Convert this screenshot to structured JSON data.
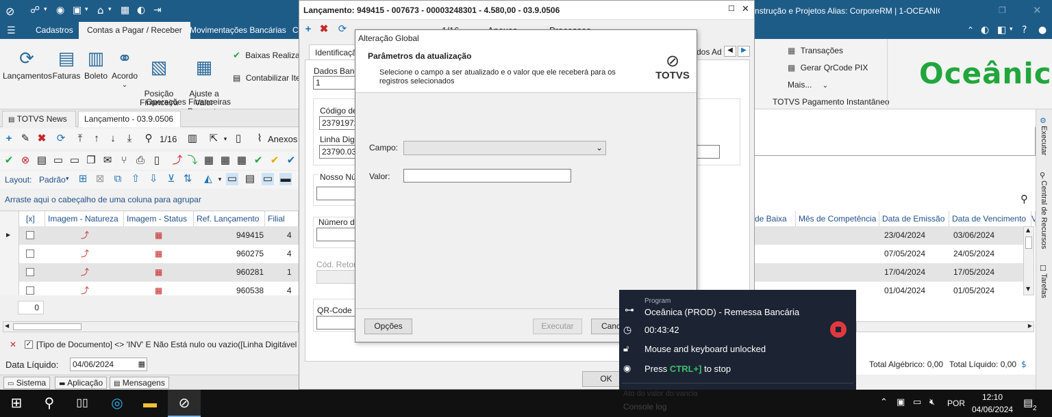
{
  "titlebar": {
    "right_text": "nstrução e Projetos  Alias: CorporeRM | 1-OCEANICA ENG..."
  },
  "menu": {
    "tabs": [
      "Cadastros",
      "Contas a Pagar / Receber",
      "Movimentações Bancárias",
      "C"
    ],
    "active": 1
  },
  "ribbon": {
    "buttons": [
      {
        "label": "Lançamentos",
        "icon": "refresh-money-icon"
      },
      {
        "label": "Faturas",
        "icon": "document-icon"
      },
      {
        "label": "Boleto",
        "icon": "barcode-icon"
      },
      {
        "label": "Acordo",
        "icon": "handshake-icon"
      },
      {
        "label": "Posição\nFinanceira",
        "icon": "report-icon"
      },
      {
        "label": "Ajuste a Valor\nPresente",
        "icon": "calculator-icon"
      }
    ],
    "small_items": [
      "Baixas Realizad",
      "Contabilizar Ite"
    ],
    "group_label": "Operações Financeiras",
    "right_items": [
      "Transações",
      "Gerar QrCode PIX",
      "Mais..."
    ],
    "right_group_label": "TOTVS Pagamento Instantâneo",
    "brand": "Oceânica"
  },
  "doctabs": {
    "tab1": "TOTVS News",
    "tab2": "Lançamento - 03.9.0506"
  },
  "toolbar": {
    "counter": "1/16",
    "anexos": "Anexos",
    "layout_label": "Layout:",
    "layout_value": "Padrão"
  },
  "grid": {
    "group_hint": "Arraste aqui o cabeçalho de uma coluna para agrupar",
    "columns": [
      "[x]",
      "Imagem - Natureza",
      "Imagem - Status",
      "Ref. Lançamento",
      "Filial"
    ],
    "right_columns": [
      "de Baixa",
      "Mês de Competência",
      "Data de Emissão",
      "Data de Vencimento",
      "V"
    ],
    "rows": [
      {
        "ref": "949415",
        "filial": "4",
        "emissao": "23/04/2024",
        "vencimento": "03/06/2024"
      },
      {
        "ref": "960275",
        "filial": "4",
        "emissao": "07/05/2024",
        "vencimento": "24/05/2024"
      },
      {
        "ref": "960281",
        "filial": "1",
        "emissao": "17/04/2024",
        "vencimento": "17/05/2024"
      },
      {
        "ref": "960538",
        "filial": "4",
        "emissao": "01/04/2024",
        "vencimento": "01/05/2024"
      }
    ],
    "footer_count": "0"
  },
  "filter": {
    "text": "[Tipo de Documento] <> 'INV' E Não Está nulo ou vazio([Linha Digitável (IPTE)])",
    "data_liquido_label": "Data Líquido:",
    "data_liquido_value": "04/06/2024"
  },
  "totals": {
    "algebrico": "Total Algébrico: 0,00",
    "liquido": "Total Líquido: 0,00"
  },
  "statusbar": [
    "Sistema",
    "Aplicação",
    "Mensagens"
  ],
  "lancamento_dialog": {
    "title": "Lançamento: 949415 - 007673 - 00003248301 - 4.580,00 - 03.9.0506",
    "counter": "1/16",
    "anexos": "Anexos",
    "processos": "Processos",
    "tab_identificacao": "Identificaçã",
    "tab_dados_ad": "dos Ad",
    "dados_bancarios_label": "Dados Banca",
    "dados_bancarios_value": "1",
    "codigo_label": "Código de",
    "codigo_value": "237919725",
    "linha_label": "Linha Digita",
    "linha_value": "23790.031",
    "nosso_numero_label": "Nosso Núm",
    "numero_label": "Número da",
    "cod_retorno_label": "Cód. Retorn",
    "qrcode_label": "QR-Code P",
    "ok_label": "OK"
  },
  "alter_dialog": {
    "title": "Alteração Global",
    "header_title": "Parâmetros da atualização",
    "header_desc": "Selecione o campo a ser atualizado e o valor que ele receberá para os registros selecionados",
    "logo_text": "TOTVS",
    "campo_label": "Campo:",
    "campo_value": "",
    "valor_label": "Valor:",
    "valor_value": "",
    "opcoes_label": "Opções",
    "executar_label": "Executar",
    "cancelar_label": "Cance"
  },
  "overlay": {
    "program_caption": "Program",
    "program_name": "Oceânica (PROD) - Remessa Bancária",
    "timer": "00:43:42",
    "unlock_text": "Mouse and keyboard unlocked",
    "press_text": "Press",
    "shortcut": "CTRL+]",
    "stop_text": "to stop",
    "faded1": "Ato do valor do vancia",
    "faded2": "Console log"
  },
  "rightside": [
    "Executar",
    "Central de Recursos",
    "Tarefas"
  ],
  "taskbar": {
    "lang": "POR",
    "time": "12:10",
    "date": "04/06/2024",
    "notif_count": "2"
  },
  "colors": {
    "title_blue": "#1e5c88",
    "brand_green": "#22a63c",
    "overlay_bg": "#1c2433",
    "stop_red": "#e0393e"
  }
}
